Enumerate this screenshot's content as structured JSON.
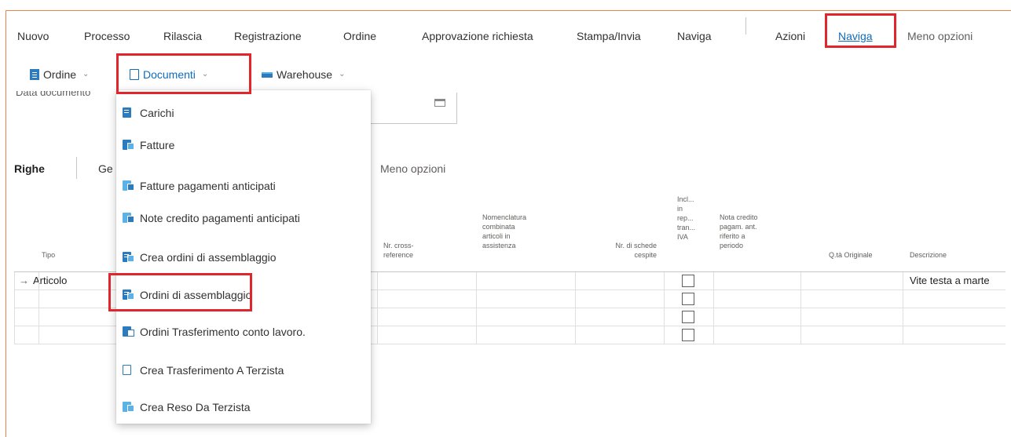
{
  "actionbar": {
    "items": [
      "Nuovo",
      "Processo",
      "Rilascia",
      "Registrazione",
      "Ordine",
      "Approvazione richiesta",
      "Stampa/Invia",
      "Naviga",
      "Azioni",
      "Naviga",
      "Meno opzioni"
    ]
  },
  "subbar": {
    "ordine": "Ordine",
    "documenti": "Documenti",
    "warehouse": "Warehouse"
  },
  "form": {
    "partial_label": "Data documento"
  },
  "lines": {
    "title": "Righe",
    "gestisci": "Ge",
    "meno_opzioni": "Meno opzioni"
  },
  "columns": {
    "tipo": "Tipo",
    "cross_ref": "Nr. cross-\nreference",
    "nomenclatura": "Nomenclatura\ncombinata\narticoli in\nassistenza",
    "scheda": "Nr. di schede\ncespite",
    "incl": "Incl...\nin\nrep...\ntran...\nIVA",
    "nota": "Nota credito\npagam. ant.\nriferito a\nperiodo",
    "qta": "Q.tà Originale",
    "descrizione": "Descrizione"
  },
  "rows": [
    {
      "tipo": "Articolo",
      "descrizione": "Vite testa a marte"
    },
    {
      "tipo": "",
      "descrizione": ""
    },
    {
      "tipo": "",
      "descrizione": ""
    },
    {
      "tipo": "",
      "descrizione": ""
    }
  ],
  "menu": {
    "items": [
      "Carichi",
      "Fatture",
      "Fatture pagamenti anticipati",
      "Note credito pagamenti anticipati",
      "Crea ordini di assemblaggio",
      "Ordini di assemblaggio",
      "Ordini Trasferimento conto lavoro.",
      "Crea Trasferimento A Terzista",
      "Crea Reso Da Terzista"
    ]
  },
  "colors": {
    "accent": "#0f6cbd",
    "highlight": "#e0262b",
    "frame": "#e8834a"
  }
}
